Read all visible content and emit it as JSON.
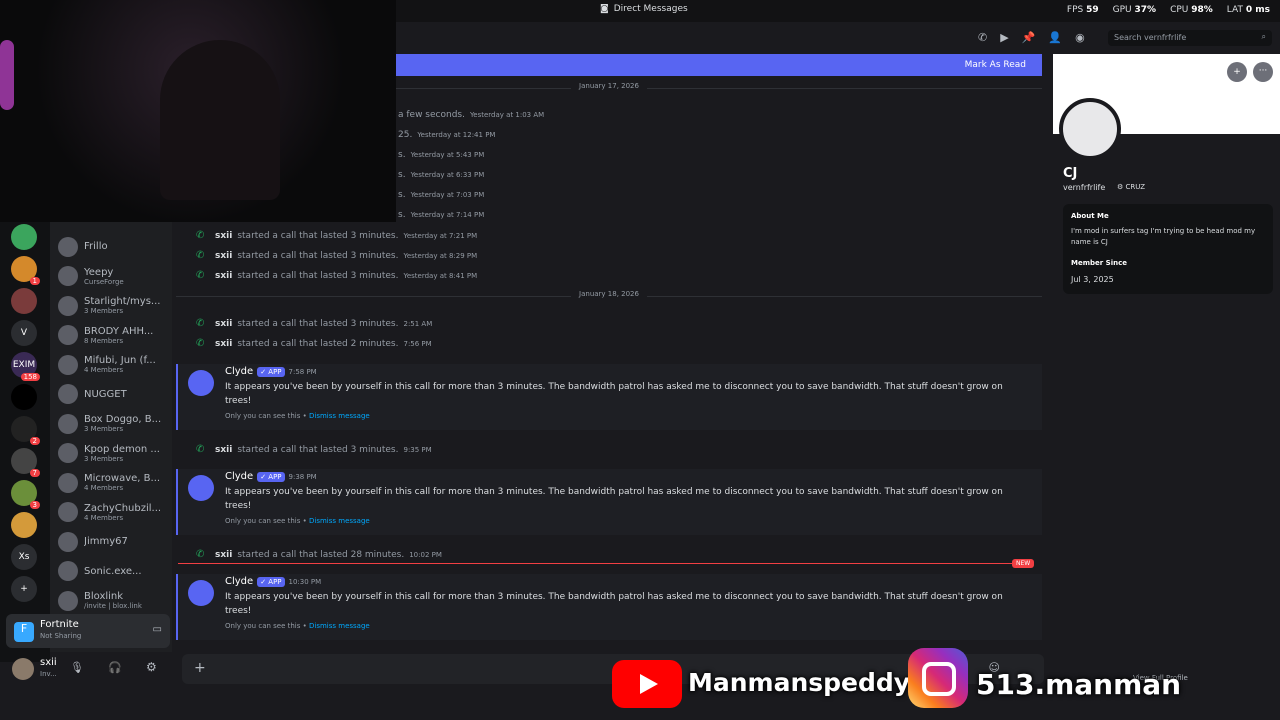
{
  "window": {
    "title": "Direct Messages"
  },
  "stats": [
    {
      "k": "FPS",
      "v": "59"
    },
    {
      "k": "GPU",
      "v": "37%"
    },
    {
      "k": "CPU",
      "v": "98%"
    },
    {
      "k": "LAT",
      "v": "0 ms"
    }
  ],
  "servers": [
    {
      "label": "",
      "color": "#3ba55d",
      "badge": ""
    },
    {
      "label": "",
      "color": "#d4892b",
      "badge": "1"
    },
    {
      "label": "",
      "color": "#7a3b3b",
      "badge": ""
    },
    {
      "label": "V",
      "color": "#2b2d31",
      "badge": ""
    },
    {
      "label": "EXIM",
      "color": "#3a2a55",
      "badge": "158"
    },
    {
      "label": "",
      "color": "#000",
      "badge": ""
    },
    {
      "label": "",
      "color": "#222",
      "badge": "2"
    },
    {
      "label": "",
      "color": "#444",
      "badge": "7"
    },
    {
      "label": "",
      "color": "#6b8f3a",
      "badge": "3"
    },
    {
      "label": "",
      "color": "#d49a3a",
      "badge": ""
    },
    {
      "label": "Xs",
      "color": "#2b2d31",
      "badge": ""
    },
    {
      "label": "+",
      "color": "#2b2d31",
      "badge": ""
    }
  ],
  "dms": [
    {
      "name": "Frillo",
      "sub": ""
    },
    {
      "name": "Yeepy",
      "sub": "CurseForge"
    },
    {
      "name": "Starlight/mys...",
      "sub": "3 Members"
    },
    {
      "name": "BRODY AHH...",
      "sub": "8 Members"
    },
    {
      "name": "Mifubi, Jun (f...",
      "sub": "4 Members"
    },
    {
      "name": "NUGGET",
      "sub": ""
    },
    {
      "name": "Box Doggo, B...",
      "sub": "3 Members"
    },
    {
      "name": "Kpop demon ...",
      "sub": "3 Members"
    },
    {
      "name": "Microwave, B...",
      "sub": "4 Members"
    },
    {
      "name": "ZachyChubzil...",
      "sub": "4 Members"
    },
    {
      "name": "Jimmy67",
      "sub": ""
    },
    {
      "name": "Sonic.exe...",
      "sub": ""
    },
    {
      "name": "Bloxlink",
      "sub": "/invite | blox.link"
    }
  ],
  "activity": {
    "game": "Fortnite",
    "status": "Not Sharing"
  },
  "user": {
    "name": "sxii",
    "status": "Inv..."
  },
  "search": {
    "placeholder": "Search vernfrfrlife"
  },
  "markbar": {
    "label": "Mark As Read"
  },
  "dates": {
    "d1": "January 17, 2026",
    "d2": "January 18, 2026"
  },
  "calls_top": [
    {
      "pre": "a few seconds.",
      "ts": "Yesterday at 1:03 AM"
    },
    {
      "pre": "25.",
      "ts": "Yesterday at 12:41 PM"
    },
    {
      "pre": "s.",
      "ts": "Yesterday at 5:43 PM"
    },
    {
      "pre": "s.",
      "ts": "Yesterday at 6:33 PM"
    },
    {
      "pre": "s.",
      "ts": "Yesterday at 7:03 PM"
    },
    {
      "pre": "s.",
      "ts": "Yesterday at 7:14 PM"
    }
  ],
  "calls": [
    {
      "user": "sxii",
      "text": "started a call that lasted 3 minutes.",
      "ts": "Yesterday at 7:21 PM"
    },
    {
      "user": "sxii",
      "text": "started a call that lasted 3 minutes.",
      "ts": "Yesterday at 8:29 PM"
    },
    {
      "user": "sxii",
      "text": "started a call that lasted 3 minutes.",
      "ts": "Yesterday at 8:41 PM"
    },
    {
      "user": "sxii",
      "text": "started a call that lasted 3 minutes.",
      "ts": "2:51 AM"
    },
    {
      "user": "sxii",
      "text": "started a call that lasted 2 minutes.",
      "ts": "7:56 PM"
    },
    {
      "user": "sxii",
      "text": "started a call that lasted 3 minutes.",
      "ts": "9:35 PM"
    },
    {
      "user": "sxii",
      "text": "started a call that lasted 28 minutes.",
      "ts": "10:02 PM"
    }
  ],
  "bot": {
    "name": "Clyde",
    "tag": "✓ APP",
    "text": "It appears you've been by yourself in this call for more than 3 minutes. The bandwidth patrol has asked me to disconnect you to save bandwidth. That stuff doesn't grow on trees!",
    "only": "Only you can see this •",
    "dismiss": "Dismiss message",
    "times": [
      "7:58 PM",
      "9:38 PM",
      "10:30 PM"
    ]
  },
  "newbadge": "NEW",
  "profile": {
    "name": "CJ",
    "handle": "vernfrfrlife",
    "tag": "CRUZ",
    "about_h": "About Me",
    "about": "I'm mod in surfers tag I'm trying to be head mod my name is CJ",
    "since_h": "Member Since",
    "since": "Jul 3, 2025",
    "fullprofile": "View Full Profile"
  },
  "overlay": {
    "yt": "Manmanspeddy",
    "ig": "513.manman"
  },
  "icons": [
    "discord-icon",
    "phone-icon",
    "video-icon",
    "pin-icon",
    "add-friend-icon",
    "profile-icon",
    "search-icon",
    "plus-icon",
    "mic-icon",
    "headphones-icon",
    "gear-icon",
    "emoji-icon",
    "more-icon"
  ]
}
